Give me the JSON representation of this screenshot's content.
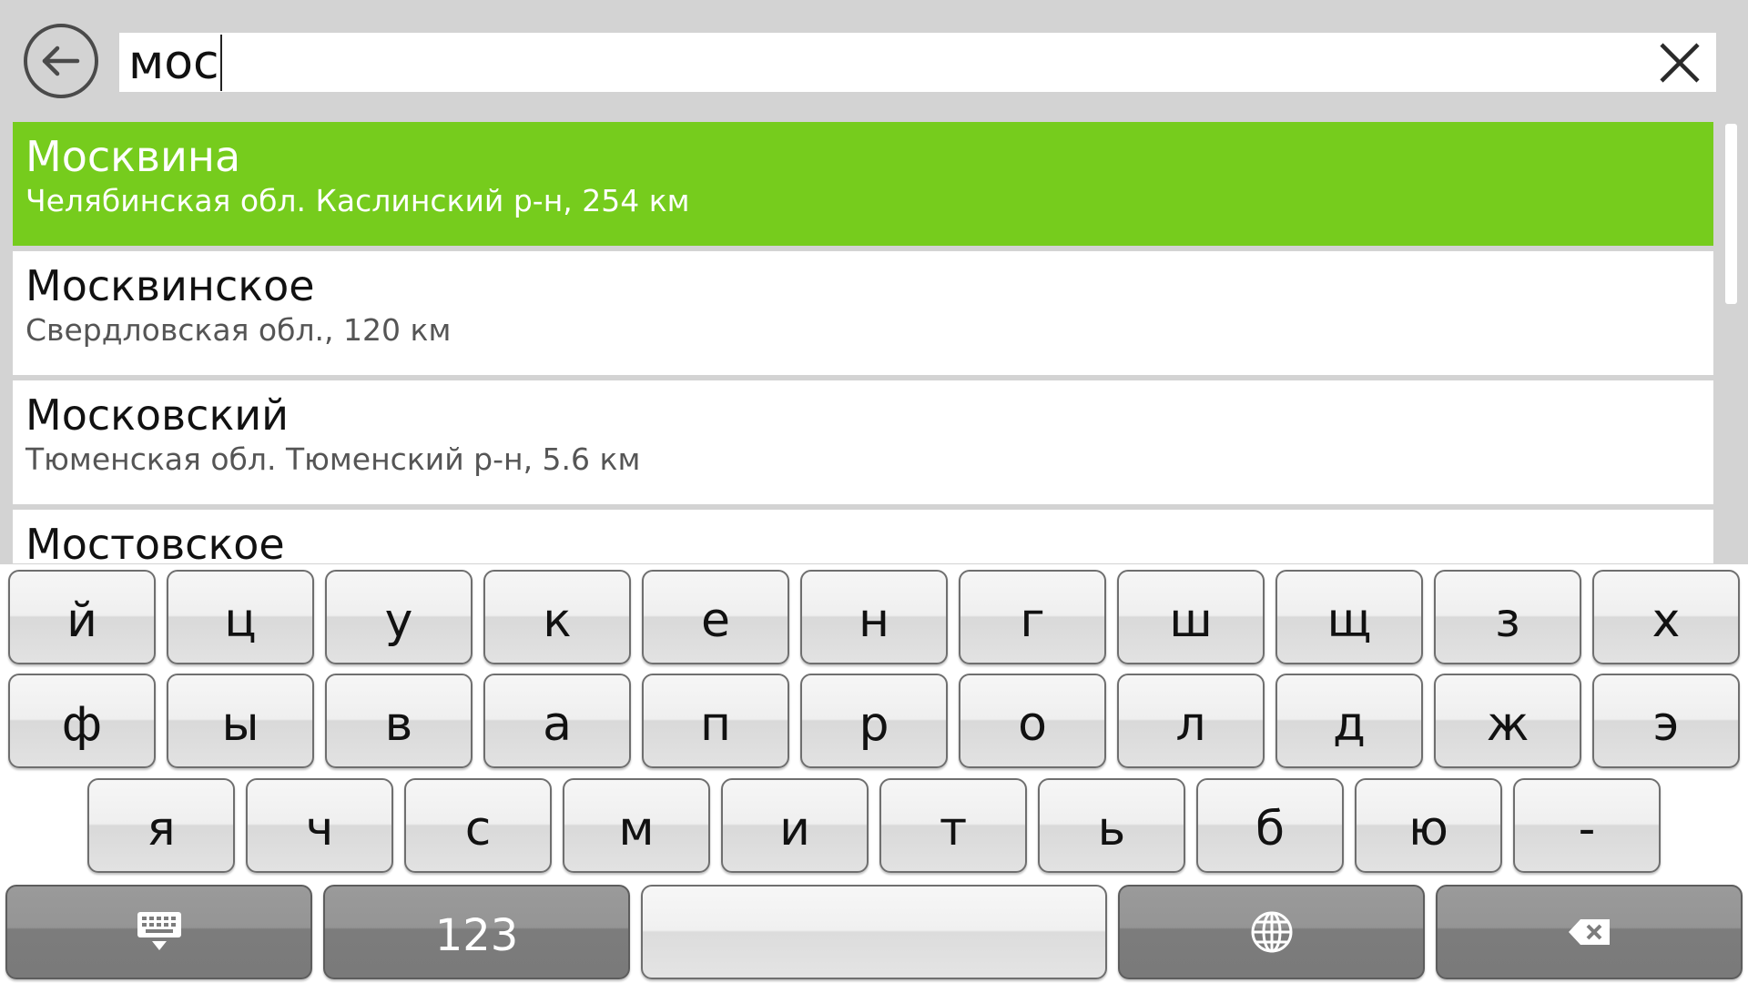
{
  "search": {
    "query": "мос"
  },
  "results": [
    {
      "title": "Москвина",
      "subtitle": "Челябинская обл. Каслинский р-н, 254 км",
      "selected": true
    },
    {
      "title": "Москвинское",
      "subtitle": "Свердловская обл., 120 км",
      "selected": false
    },
    {
      "title": "Московский",
      "subtitle": "Тюменская обл. Тюменский р-н, 5.6 км",
      "selected": false
    },
    {
      "title": "Мостовское",
      "subtitle": "",
      "selected": false
    }
  ],
  "keyboard": {
    "row1": [
      "й",
      "ц",
      "у",
      "к",
      "е",
      "н",
      "г",
      "ш",
      "щ",
      "з",
      "х"
    ],
    "row2": [
      "ф",
      "ы",
      "в",
      "а",
      "п",
      "р",
      "о",
      "л",
      "д",
      "ж",
      "э"
    ],
    "row3": [
      "я",
      "ч",
      "с",
      "м",
      "и",
      "т",
      "ь",
      "б",
      "ю",
      "-"
    ],
    "numeric_label": "123"
  },
  "icons": {
    "back": "back-arrow-icon",
    "clear": "close-icon",
    "hide_keyboard": "keyboard-hide-icon",
    "language": "globe-icon",
    "backspace": "backspace-icon"
  },
  "colors": {
    "selected_row": "#76cc1d",
    "background": "#d3d3d3",
    "function_key": "#7c7c7c"
  }
}
